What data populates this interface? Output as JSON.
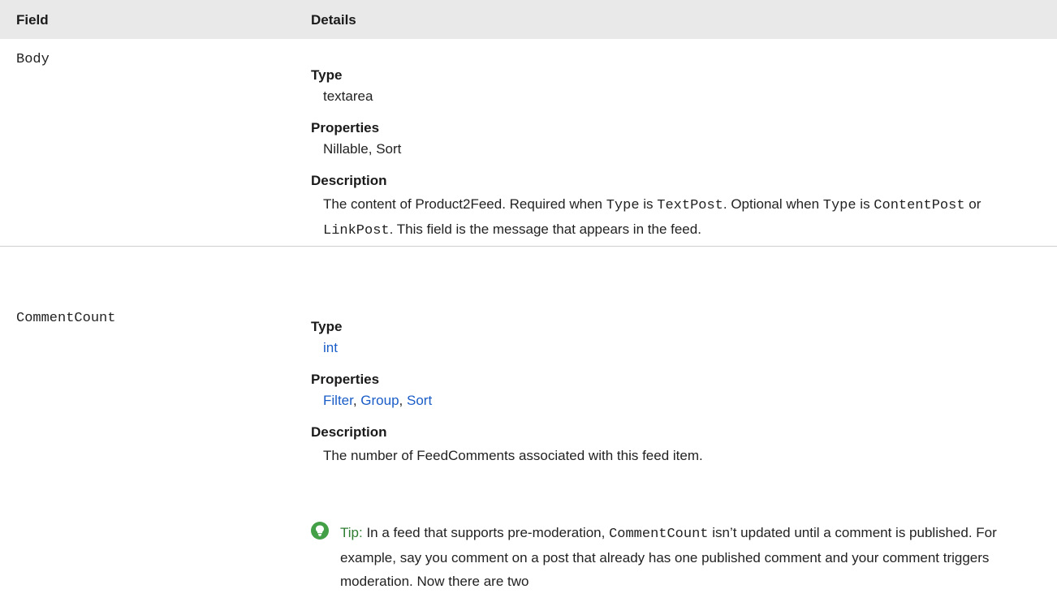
{
  "header": {
    "field": "Field",
    "details": "Details"
  },
  "rows": [
    {
      "name": "Body",
      "type_label": "Type",
      "type_value": "textarea",
      "properties_label": "Properties",
      "properties_value": "Nillable, Sort",
      "description_label": "Description",
      "description": {
        "p1": "The content of Product2Feed. Required when ",
        "code1": "Type",
        "p2": " is ",
        "code2": "TextPost",
        "p3": ". Optional when ",
        "code3": "Type",
        "p4": " is ",
        "code4": "ContentPost",
        "p5": " or ",
        "code5": "LinkPost",
        "p6": ". This field is the message that appears in the feed."
      }
    },
    {
      "name": "CommentCount",
      "type_label": "Type",
      "type_value": "int",
      "properties_label": "Properties",
      "properties": [
        "Filter",
        "Group",
        "Sort"
      ],
      "properties_sep": ", ",
      "description_label": "Description",
      "description": "The number of FeedComments associated with this feed item.",
      "tip": {
        "icon": "lightbulb-icon",
        "label": "Tip:",
        "t1": " In a feed that supports pre-moderation, ",
        "code": "CommentCount",
        "t2": " isn’t updated until a comment is published. For example, say you comment on a post that already has one published comment and your comment triggers moderation. Now there are two"
      }
    }
  ],
  "colors": {
    "header_bg": "#e9e9ea",
    "link": "#1a5dc7",
    "tip_green": "#43a047"
  }
}
